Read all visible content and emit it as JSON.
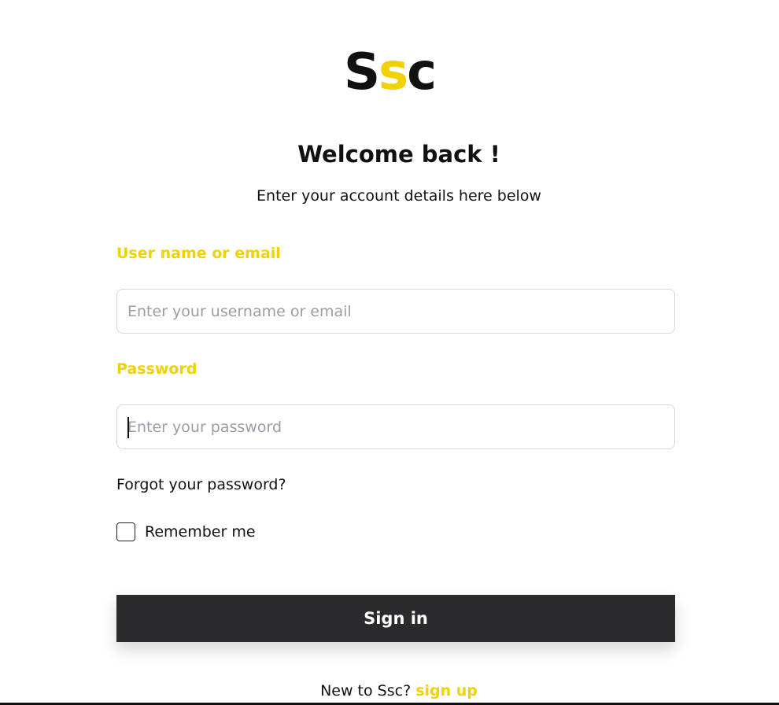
{
  "colors": {
    "accent": "#f2d100",
    "text": "#111111",
    "button_bg": "#2b2b2d",
    "button_text": "#ffffff"
  },
  "logo": {
    "first": "S",
    "middle": "s",
    "last": "c"
  },
  "welcome": {
    "title": "Welcome back !",
    "subtitle": "Enter your account details here below"
  },
  "form": {
    "username": {
      "label": "User name or email",
      "placeholder": "Enter your username or email",
      "value": ""
    },
    "password": {
      "label": "Password",
      "placeholder": "Enter your password",
      "value": ""
    },
    "forgot_link": "Forgot your password?",
    "remember_label": "Remember me",
    "remember_checked": false,
    "submit_label": "Sign in"
  },
  "footer": {
    "prompt": "New to Ssc?",
    "signup_link": "sign up"
  }
}
